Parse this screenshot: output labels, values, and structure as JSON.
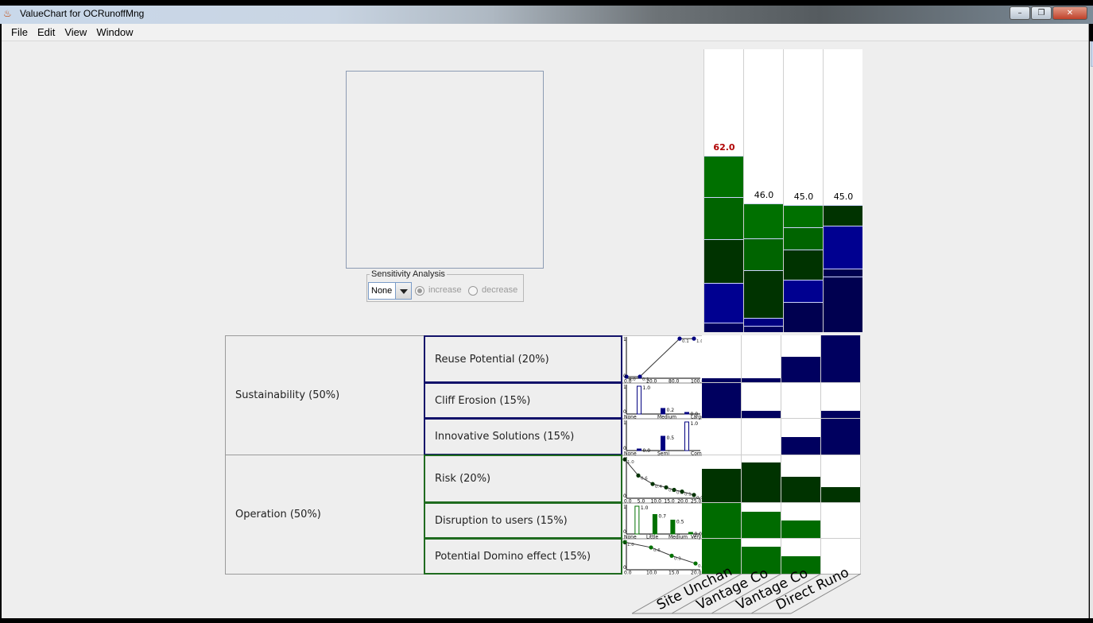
{
  "window": {
    "title": "ValueChart for OCRunoffMng",
    "buttons": {
      "minimize": "–",
      "maximize": "❐",
      "close": "✕"
    }
  },
  "menu": [
    "File",
    "Edit",
    "View",
    "Window"
  ],
  "sensitivity": {
    "legend": "Sensitivity Analysis",
    "selected": "None",
    "increase_label": "increase",
    "decrease_label": "decrease",
    "increase_selected": true
  },
  "colors": {
    "sustainability": "#00005f",
    "operation": "#003300",
    "blue_dark": "#000050",
    "blue_mid": "#000080",
    "green_dark": "#004000",
    "green_mid": "#006400",
    "green_light": "#007000",
    "top_score": "#b00000"
  },
  "objectives": {
    "parents": [
      {
        "label": "Sustainability (50%)"
      },
      {
        "label": "Operation (50%)"
      }
    ],
    "children": [
      {
        "label": "Reuse Potential (20%)"
      },
      {
        "label": "Cliff Erosion (15%)"
      },
      {
        "label": "Innovative Solutions (15%)"
      },
      {
        "label": "Risk (20%)"
      },
      {
        "label": "Disruption to users (15%)"
      },
      {
        "label": "Potential Domino effect (15%)"
      }
    ]
  },
  "value_functions": [
    {
      "name": "reuse",
      "kind": "line",
      "x_ticks": [
        "0.0",
        "20.0",
        "80.0",
        "100.0"
      ],
      "point_labels": [
        "0.0",
        "0.1",
        "0.1",
        "1.0",
        "1.0"
      ],
      "y_axis": [
        "1",
        "0"
      ]
    },
    {
      "name": "cliff",
      "kind": "bar",
      "x_ticks": [
        "None",
        "Medium",
        "Large"
      ],
      "values": [
        1.0,
        0.2,
        0.0
      ],
      "value_labels": [
        "1.0",
        "0.2",
        "0.0"
      ],
      "y_axis": [
        "1",
        "0"
      ]
    },
    {
      "name": "innovative",
      "kind": "bar",
      "x_ticks": [
        "None",
        "Semi",
        "Completely"
      ],
      "values": [
        0.0,
        0.5,
        1.0
      ],
      "value_labels": [
        "0.0",
        "0.5",
        "1.0"
      ],
      "y_axis": [
        "1",
        "0"
      ]
    },
    {
      "name": "risk",
      "kind": "line",
      "x_ticks": [
        "0.0",
        "5.0",
        "10.0",
        "15.0",
        "20.0",
        "25.0"
      ],
      "point_labels": [
        "1.0",
        "0.6",
        "0.4",
        "0.3",
        "0.2",
        "0.1",
        "0.0"
      ],
      "y_axis": [
        "1",
        "0"
      ]
    },
    {
      "name": "disruption",
      "kind": "bar",
      "x_ticks": [
        "None",
        "Little",
        "Medium",
        "Very"
      ],
      "values": [
        1.0,
        0.7,
        0.5,
        0.0
      ],
      "value_labels": [
        "1.0",
        "0.7",
        "0.5",
        "0.0"
      ],
      "y_axis": [
        "1",
        "0"
      ]
    },
    {
      "name": "domino",
      "kind": "line",
      "x_ticks": [
        "0.0",
        "10.0",
        "15.0",
        "20.0"
      ],
      "point_labels": [
        "1.0",
        "0.6",
        "0.3",
        "0.0"
      ],
      "y_axis": [
        "1",
        "0"
      ]
    }
  ],
  "alternatives": [
    {
      "label": "Site Unchan",
      "score": "62.0",
      "top": true
    },
    {
      "label": "Vantage Co",
      "score": "46.0",
      "top": false
    },
    {
      "label": "Vantage Co",
      "score": "45.0",
      "top": false
    },
    {
      "label": "Direct Runo",
      "score": "45.0",
      "top": false
    }
  ]
}
